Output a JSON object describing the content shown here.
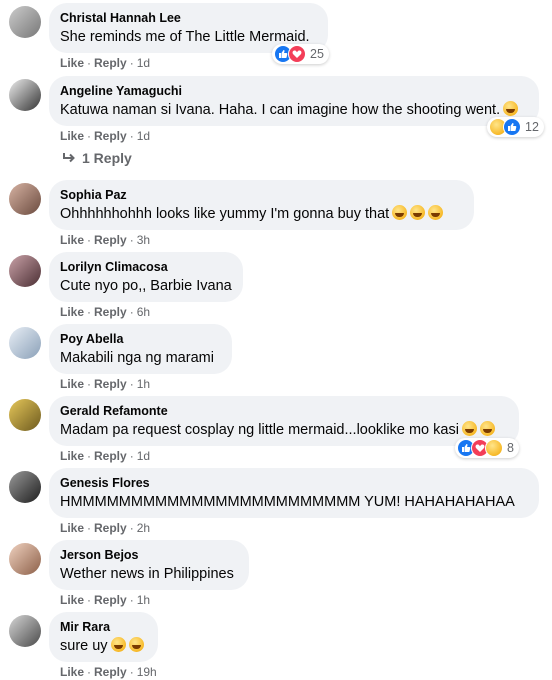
{
  "comments": [
    {
      "author": "Christal Hannah Lee",
      "text": "She reminds me of The Little Mermaid.",
      "like": "Like",
      "reply": "Reply",
      "time": "1d",
      "reaction_count": "25",
      "avatar_color": "#9a9a9a"
    },
    {
      "author": "Angeline Yamaguchi",
      "text": "Katuwa naman si Ivana. Haha. I can imagine how the shooting went.",
      "like": "Like",
      "reply": "Reply",
      "time": "1d",
      "reaction_count": "12",
      "avatar_color": "#5b6b7a"
    },
    {
      "author": "Sophia Paz",
      "text": "Ohhhhhhohhh looks like yummy I'm gonna buy that",
      "like": "Like",
      "reply": "Reply",
      "time": "3h",
      "avatar_color": "#b08a7a"
    },
    {
      "author": "Lorilyn Climacosa",
      "text": "Cute nyo po,, Barbie Ivana",
      "like": "Like",
      "reply": "Reply",
      "time": "6h",
      "avatar_color": "#8a6a6e"
    },
    {
      "author": "Poy Abella",
      "text": "Makabili nga ng marami",
      "like": "Like",
      "reply": "Reply",
      "time": "1h",
      "avatar_color": "#c9d4e0"
    },
    {
      "author": "Gerald Refamonte",
      "text": "Madam pa request cosplay ng little mermaid...looklike mo kasi",
      "like": "Like",
      "reply": "Reply",
      "time": "1d",
      "reaction_count": "8",
      "avatar_color": "#c8a53a"
    },
    {
      "author": "Genesis Flores",
      "text": "HMMMMMMMMMMMMMMMMMMMMMMMM YUM! HAHAHAHAHAA",
      "like": "Like",
      "reply": "Reply",
      "time": "2h",
      "avatar_color": "#4b4b4b"
    },
    {
      "author": "Jerson Bejos",
      "text": "Wether news in Philippines",
      "like": "Like",
      "reply": "Reply",
      "time": "1h",
      "avatar_color": "#c79a80"
    },
    {
      "author": "Mir Rara",
      "text": "sure uy",
      "like": "Like",
      "reply": "Reply",
      "time": "19h",
      "avatar_color": "#7a7a7a"
    }
  ],
  "replies_link": "1 Reply",
  "colors": {
    "bubble": "#f0f2f5",
    "meta": "#65676b",
    "like_blue": "#1877f2",
    "love_red": "#f33e58"
  }
}
